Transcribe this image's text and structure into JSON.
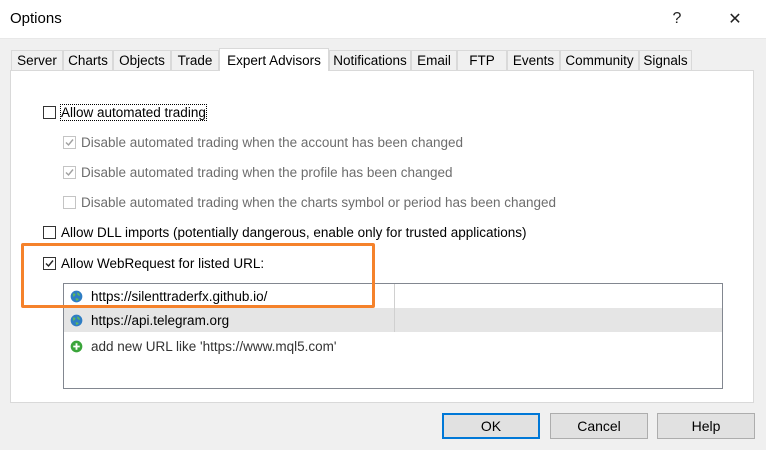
{
  "window": {
    "title": "Options",
    "help_glyph": "?",
    "close_glyph": "✕"
  },
  "tabs": [
    {
      "label": "Server"
    },
    {
      "label": "Charts"
    },
    {
      "label": "Objects"
    },
    {
      "label": "Trade"
    },
    {
      "label": "Expert Advisors",
      "active": true
    },
    {
      "label": "Notifications"
    },
    {
      "label": "Email"
    },
    {
      "label": "FTP"
    },
    {
      "label": "Events"
    },
    {
      "label": "Community"
    },
    {
      "label": "Signals"
    }
  ],
  "options": {
    "allow_automated_trading": {
      "label": "Allow automated trading",
      "checked": false,
      "enabled": true
    },
    "disable_on_account_change": {
      "label": "Disable automated trading when the account has been changed",
      "checked": true,
      "enabled": false
    },
    "disable_on_profile_change": {
      "label": "Disable automated trading when the profile has been changed",
      "checked": true,
      "enabled": false
    },
    "disable_on_chart_change": {
      "label": "Disable automated trading when the charts symbol or period has been changed",
      "checked": false,
      "enabled": false
    },
    "allow_dll_imports": {
      "label": "Allow DLL imports (potentially dangerous, enable only for trusted applications)",
      "checked": false,
      "enabled": true
    },
    "allow_webrequest": {
      "label": "Allow WebRequest for listed URL:",
      "checked": true,
      "enabled": true
    }
  },
  "url_list": {
    "items": [
      {
        "url": "https://silenttraderfx.github.io/",
        "selected": false
      },
      {
        "url": "https://api.telegram.org",
        "selected": true
      }
    ],
    "add_hint": "add new URL like 'https://www.mql5.com'"
  },
  "buttons": {
    "ok": "OK",
    "cancel": "Cancel",
    "help": "Help"
  },
  "colors": {
    "highlight": "#f5822b",
    "globe": "#2e7dc4",
    "add": "#3aa53a"
  }
}
